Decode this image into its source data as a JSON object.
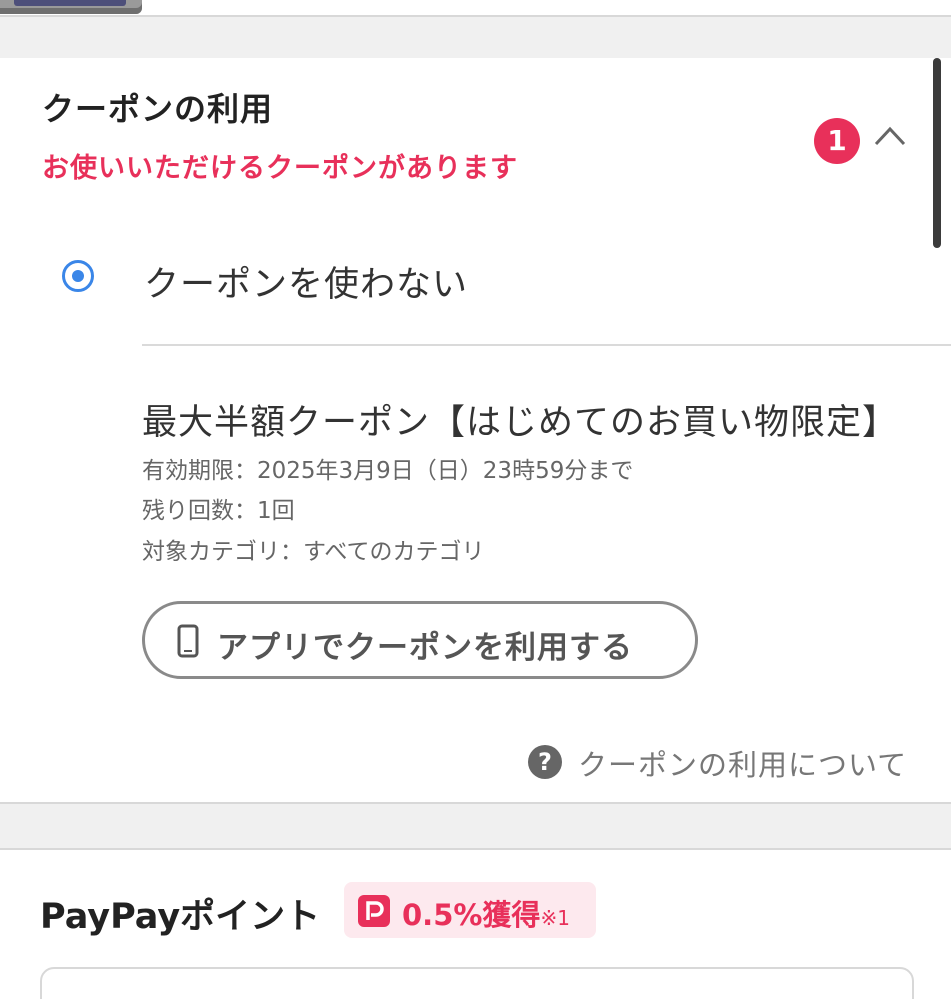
{
  "coupon_section": {
    "title": "クーポンの利用",
    "notice": "お使いいただけるクーポンがあります",
    "badge_count": "1",
    "radio_option_label": "クーポンを使わない",
    "coupon": {
      "name": "最大半額クーポン【はじめてのお買い物限定】",
      "expiry": "有効期限：2025年3月9日（日）23時59分まで",
      "remaining": "残り回数：1回",
      "category": "対象カテゴリ：すべてのカテゴリ"
    },
    "app_button_label": "アプリでクーポンを利用する",
    "help_link_label": "クーポンの利用について",
    "help_icon_glyph": "?"
  },
  "paypay_section": {
    "title": "PayPayポイント",
    "rate": "0.5%獲得",
    "rate_note": "※1"
  },
  "colors": {
    "accent_red": "#e8305a",
    "radio_blue": "#3a86e8"
  },
  "icons": [
    "chevron-up-icon",
    "phone-icon",
    "question-icon",
    "paypay-logo-icon"
  ]
}
